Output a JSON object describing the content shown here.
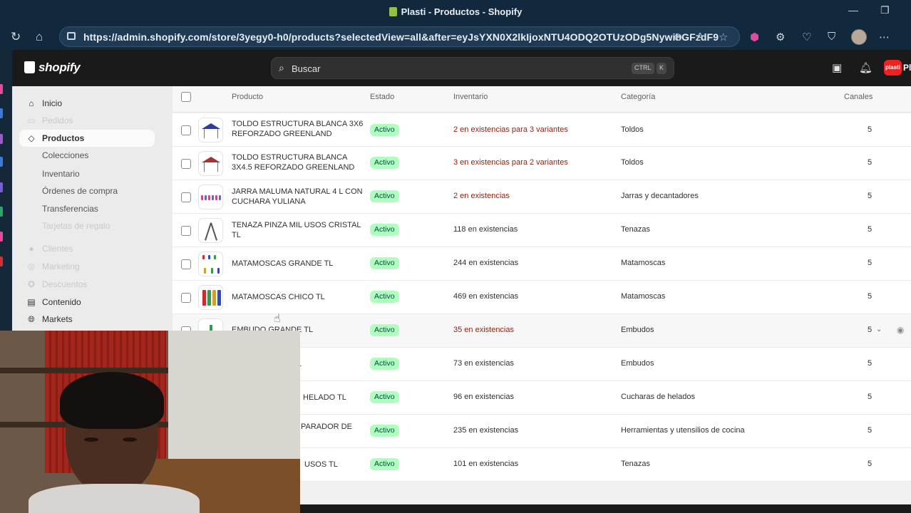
{
  "browser": {
    "title": "Plasti - Productos - Shopify",
    "url": "https://admin.shopify.com/store/3yegy0-h0/products?selectedView=all&after=eyJsYXN0X2lkIjoxNTU4ODQ2OTUzODg5NywibGFzdF9"
  },
  "topbar": {
    "logo": "shopify",
    "search_placeholder": "Buscar",
    "kbd_ctrl": "CTRL",
    "kbd_k": "K",
    "store_badge": "plasti",
    "store_name": "Pl"
  },
  "sidebar": {
    "items": [
      {
        "label": "Inicio",
        "icon": "home-icon"
      },
      {
        "label": "Pedidos",
        "icon": "inbox-icon"
      },
      {
        "label": "Productos",
        "icon": "tag-icon"
      },
      {
        "label": "Colecciones"
      },
      {
        "label": "Inventario"
      },
      {
        "label": "Órdenes de compra"
      },
      {
        "label": "Transferencias"
      },
      {
        "label": "Tarjetas de regalo"
      },
      {
        "label": "Clientes",
        "icon": "person-icon"
      },
      {
        "label": "Marketing",
        "icon": "target-icon"
      },
      {
        "label": "Descuentos",
        "icon": "discount-icon"
      },
      {
        "label": "Contenido",
        "icon": "content-icon"
      },
      {
        "label": "Markets",
        "icon": "globe-icon"
      }
    ]
  },
  "table": {
    "headers": {
      "product": "Producto",
      "status": "Estado",
      "inventory": "Inventario",
      "category": "Categoría",
      "channels": "Canales"
    },
    "rows": [
      {
        "name": "TOLDO ESTRUCTURA BLANCA 3X6 REFORZADO GREENLAND",
        "status": "Activo",
        "inventory": "2 en existencias para 3 variantes",
        "category": "Toldos",
        "channels": "5"
      },
      {
        "name": "TOLDO ESTRUCTURA BLANCA 3X4.5 REFORZADO GREENLAND",
        "status": "Activo",
        "inventory": "3 en existencias para 2 variantes",
        "category": "Toldos",
        "channels": "5"
      },
      {
        "name": "JARRA MALUMA NATURAL 4 L CON CUCHARA YULIANA",
        "status": "Activo",
        "inventory": "2 en existencias",
        "category": "Jarras y decantadores",
        "channels": "5"
      },
      {
        "name": "TENAZA PINZA MIL USOS CRISTAL TL",
        "status": "Activo",
        "inventory": "118 en existencias",
        "category": "Tenazas",
        "channels": "5"
      },
      {
        "name": "MATAMOSCAS GRANDE TL",
        "status": "Activo",
        "inventory": "244 en existencias",
        "category": "Matamoscas",
        "channels": "5"
      },
      {
        "name": "MATAMOSCAS CHICO TL",
        "status": "Activo",
        "inventory": "469 en existencias",
        "category": "Matamoscas",
        "channels": "5"
      },
      {
        "name": "EMBUDO GRANDE TL",
        "status": "Activo",
        "inventory": "35 en existencias",
        "category": "Embudos",
        "channels": "5"
      },
      {
        "name": "TL",
        "status": "Activo",
        "inventory": "73 en existencias",
        "category": "Embudos",
        "channels": "5"
      },
      {
        "name": "HELADO TL",
        "status": "Activo",
        "inventory": "96 en existencias",
        "category": "Cucharas de helados",
        "channels": "5"
      },
      {
        "name": "PARADOR DE",
        "status": "Activo",
        "inventory": "235 en existencias",
        "category": "Herramientas y utensilios de cocina",
        "channels": "5"
      },
      {
        "name": "USOS TL",
        "status": "Activo",
        "inventory": "101 en existencias",
        "category": "Tenazas",
        "channels": "5"
      }
    ]
  }
}
